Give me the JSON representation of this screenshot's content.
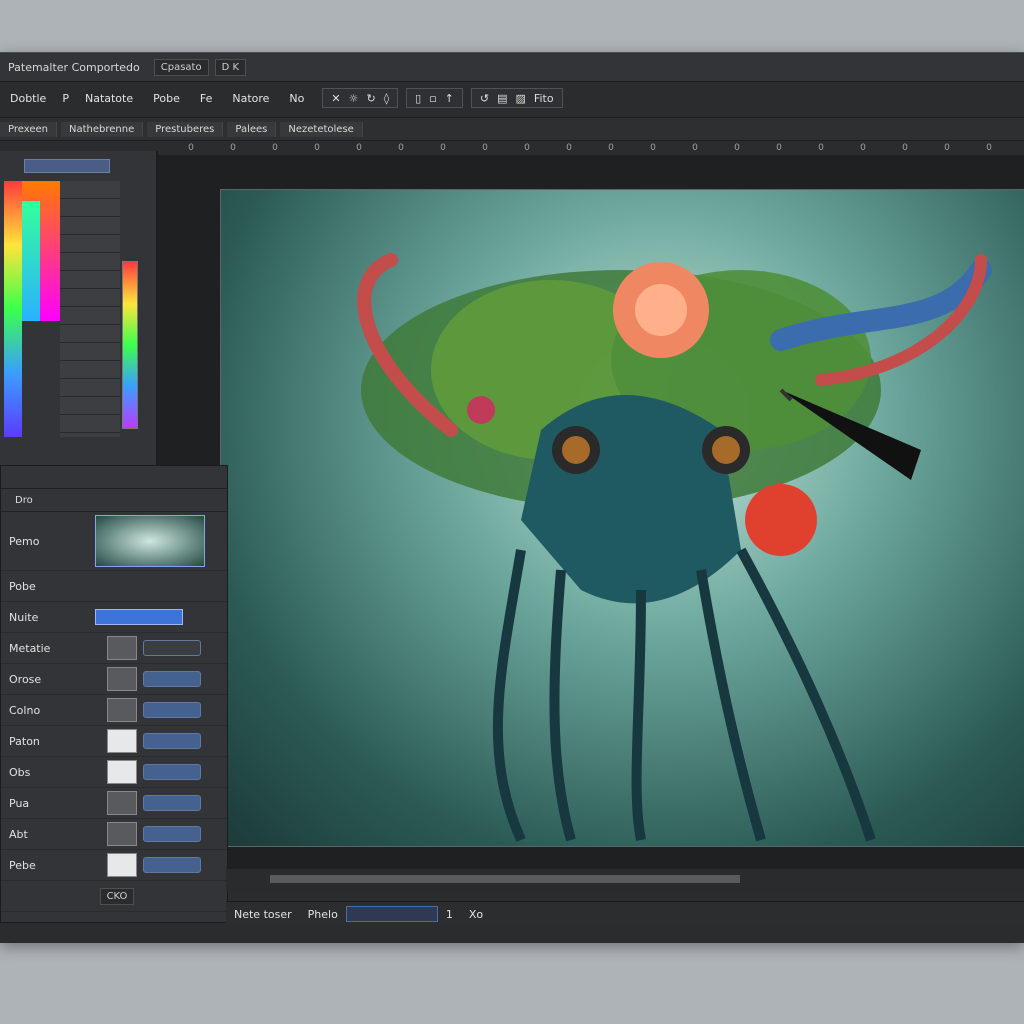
{
  "window": {
    "title": "Patemalter Comportedo",
    "tab_buttons": [
      "Cpasato",
      "D K"
    ]
  },
  "menubar": {
    "items": [
      "Dobtle",
      "P",
      "Natatote",
      "Pobe",
      "Fe",
      "Natore",
      "No"
    ],
    "toolbar_icons": [
      "x-icon",
      "sun-icon",
      "refresh-icon",
      "drop-icon",
      "page-icon",
      "lock-icon",
      "arrow-up-icon",
      "rewind-icon",
      "paste-icon",
      "image-icon"
    ],
    "toolbar_label": "Fito"
  },
  "tabs": [
    "Prexeen",
    "Nathebrenne",
    "Prestuberes",
    "Palees",
    "Nezetetolese"
  ],
  "ruler": [
    "0",
    "0",
    "0",
    "0",
    "0",
    "0",
    "0",
    "0",
    "0",
    "0",
    "0",
    "0",
    "0",
    "0",
    "0",
    "0",
    "0",
    "0",
    "0",
    "0"
  ],
  "properties": {
    "header": "Dro",
    "rows": [
      {
        "label": "Pemo"
      },
      {
        "label": "Pobe"
      },
      {
        "label": "Nuite"
      },
      {
        "label": "Metatie"
      },
      {
        "label": "Orose"
      },
      {
        "label": "Colno"
      },
      {
        "label": "Paton"
      },
      {
        "label": "Obs"
      },
      {
        "label": "Pua"
      },
      {
        "label": "Abt"
      },
      {
        "label": "Pebe"
      }
    ],
    "footer_button": "CKO"
  },
  "statusbar": {
    "left": "Nete toser",
    "mid": "Phelo",
    "page": "1",
    "right": "Xo"
  },
  "colors": {
    "accent": "#3d74d9",
    "panel": "#333437",
    "background": "#2b2c2e"
  }
}
